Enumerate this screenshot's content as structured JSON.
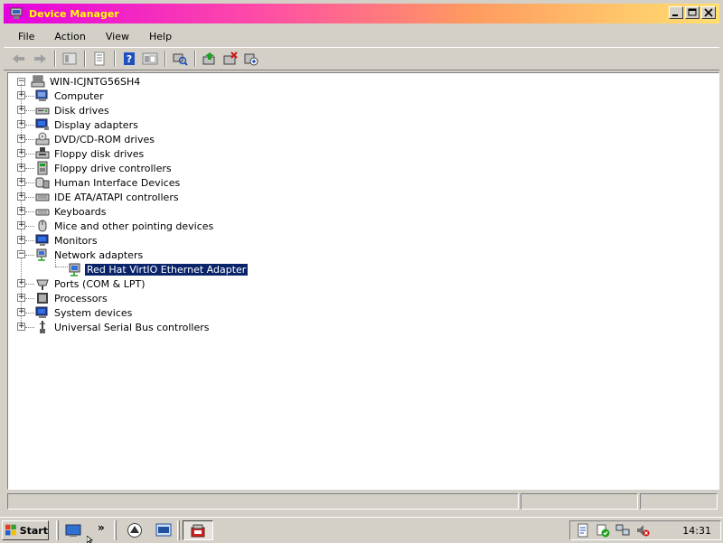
{
  "window": {
    "title": "Device Manager"
  },
  "menu": [
    {
      "label": "File"
    },
    {
      "label": "Action"
    },
    {
      "label": "View"
    },
    {
      "label": "Help"
    }
  ],
  "toolbar": {
    "icons": [
      "back-icon",
      "forward-icon",
      "up-tree-icon",
      "properties-icon",
      "help-icon",
      "show-hide-console-icon",
      "scan-hardware-icon",
      "update-driver-icon",
      "uninstall-icon",
      "disable-icon"
    ]
  },
  "tree": {
    "root": "WIN-ICJNTG56SH4",
    "categories": [
      {
        "label": "Computer",
        "icon": "computer-icon"
      },
      {
        "label": "Disk drives",
        "icon": "disk-drive-icon"
      },
      {
        "label": "Display adapters",
        "icon": "display-adapter-icon"
      },
      {
        "label": "DVD/CD-ROM drives",
        "icon": "dvd-drive-icon"
      },
      {
        "label": "Floppy disk drives",
        "icon": "floppy-drive-icon"
      },
      {
        "label": "Floppy drive controllers",
        "icon": "floppy-controller-icon"
      },
      {
        "label": "Human Interface Devices",
        "icon": "hid-icon"
      },
      {
        "label": "IDE ATA/ATAPI controllers",
        "icon": "ide-controller-icon"
      },
      {
        "label": "Keyboards",
        "icon": "keyboard-icon"
      },
      {
        "label": "Mice and other pointing devices",
        "icon": "mouse-icon"
      },
      {
        "label": "Monitors",
        "icon": "monitor-icon"
      },
      {
        "label": "Network adapters",
        "icon": "network-adapter-icon",
        "expanded": true,
        "children": [
          {
            "label": "Red Hat VirtIO Ethernet Adapter",
            "selected": true
          }
        ]
      },
      {
        "label": "Ports (COM & LPT)",
        "icon": "port-icon"
      },
      {
        "label": "Processors",
        "icon": "processor-icon"
      },
      {
        "label": "System devices",
        "icon": "system-device-icon"
      },
      {
        "label": "Universal Serial Bus controllers",
        "icon": "usb-icon"
      }
    ]
  },
  "taskbar": {
    "start_label": "Start",
    "chevron": "»",
    "clock": "14:31"
  },
  "colors": {
    "selection": "#0a246a",
    "title_text": "#ffff00"
  }
}
